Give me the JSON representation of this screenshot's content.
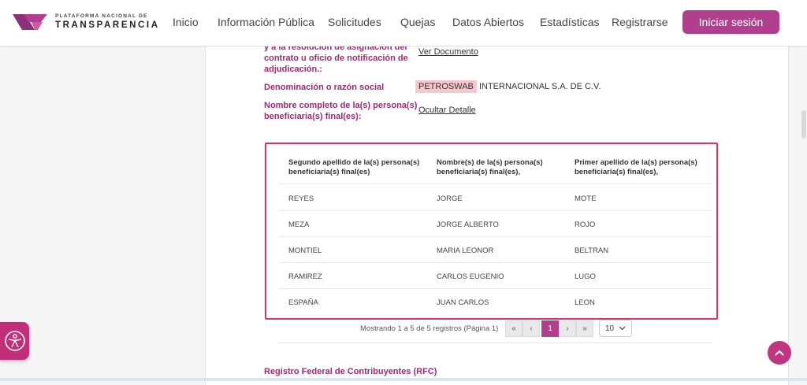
{
  "logo": {
    "line1": "PLATAFORMA NACIONAL DE",
    "line2": "TRANSPARENCIA"
  },
  "nav": {
    "items": [
      "Inicio",
      "Información Pública",
      "Solicitudes",
      "Quejas",
      "Datos Abiertos",
      "Estadísticas",
      "Registrarse"
    ],
    "login": "Iniciar sesión"
  },
  "details": {
    "contract_label_l1": "y a la resolución de asignación del",
    "contract_label_l2": "contrato u oficio de notificación de",
    "contract_label_l3": "adjudicación.:",
    "contract_link": "Ver Documento",
    "company_label": "Denominación o razón social",
    "company_highlight": "PETROSWAB",
    "company_rest": "INTERNACIONAL S.A. DE C.V.",
    "beneficiary_label_l1": "Nombre completo de la(s) persona(s)",
    "beneficiary_label_l2": "beneficiaria(s) final(es):",
    "beneficiary_link": "Ocultar Detalle",
    "rfc_label": "Registro Federal de Contribuyentes (RFC)"
  },
  "table": {
    "headers": [
      {
        "l1": "Segundo apellido de la(s) persona(s)",
        "l2": "beneficiaria(s) final(es)"
      },
      {
        "l1": "Nombre(s) de la(s) persona(s)",
        "l2": "beneficiaria(s) final(es),"
      },
      {
        "l1": "Primer apellido de la(s) persona(s)",
        "l2": "beneficiaria(s) final(es),"
      }
    ],
    "rows": [
      [
        "REYES",
        "JORGE",
        "MOTE"
      ],
      [
        "MEZA",
        "JORGE ALBERTO",
        "ROJO"
      ],
      [
        "MONTIEL",
        "MARIA LEONOR",
        "BELTRAN"
      ],
      [
        "RAMIREZ",
        "CARLOS EUGENIO",
        "LUGO"
      ],
      [
        "ESPAÑA",
        "JUAN CARLOS",
        "LEON"
      ]
    ]
  },
  "pagination": {
    "info": "Mostrando 1 a 5 de 5 registros (Página 1)",
    "first": "«",
    "prev": "‹",
    "current": "1",
    "next": "›",
    "last": "»",
    "page_size": "10"
  },
  "icons": {
    "accessibility": "accessibility-icon",
    "scroll_top": "chevron-up-icon",
    "page_size_chevron": "chevron-down-icon"
  },
  "colors": {
    "brand": "#b0408e",
    "label": "#9c2a74",
    "table_border": "#d9336e",
    "highlight": "#f7c6cf"
  }
}
